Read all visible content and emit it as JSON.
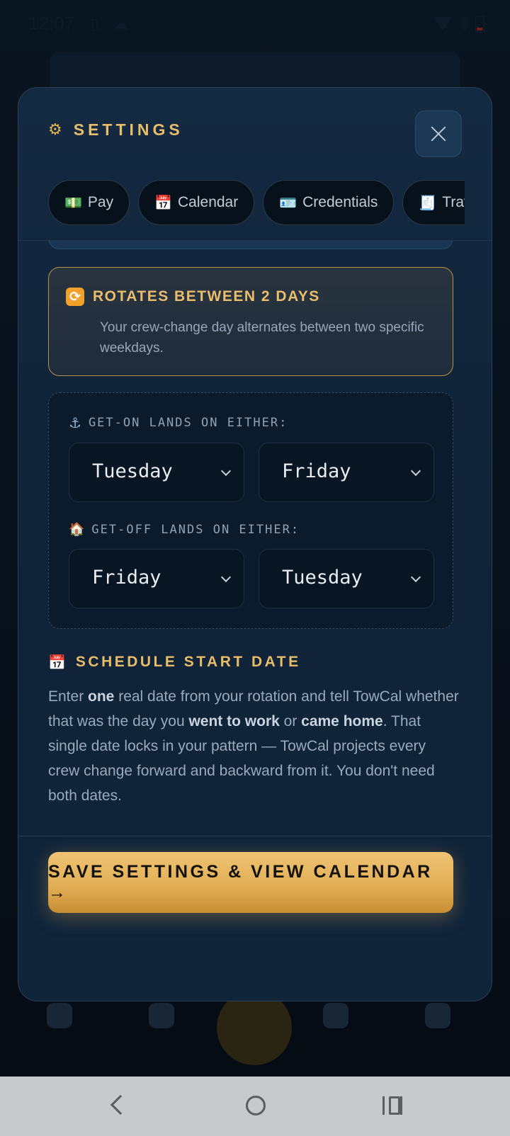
{
  "status_bar": {
    "time": "12:07",
    "left_icons": "▯ ☁"
  },
  "modal": {
    "title": "SETTINGS",
    "tabs": [
      {
        "icon": "💵",
        "label": "Pay"
      },
      {
        "icon": "📅",
        "label": "Calendar"
      },
      {
        "icon": "🪪",
        "label": "Credentials"
      },
      {
        "icon": "🧾",
        "label": "Travel"
      }
    ],
    "mode_card": {
      "title": "ROTATES BETWEEN 2 DAYS",
      "description": "Your crew-change day alternates between two specific weekdays."
    },
    "get_on": {
      "label": "GET-ON LANDS ON EITHER:",
      "day_1": "Tuesday",
      "day_2": "Friday"
    },
    "get_off": {
      "label": "GET-OFF LANDS ON EITHER:",
      "day_1": "Friday",
      "day_2": "Tuesday"
    },
    "schedule_start": {
      "heading": "SCHEDULE START DATE",
      "desc_1": "Enter ",
      "desc_b1": "one",
      "desc_2": " real date from your rotation and tell TowCal whether that was the day you ",
      "desc_b2": "went to work",
      "desc_3": " or ",
      "desc_b3": "came home",
      "desc_4": ". That single date locks in your pattern — TowCal projects every crew change forward and backward from it. You don't need both dates."
    },
    "save_label": "SAVE SETTINGS & VIEW CALENDAR →"
  },
  "colors": {
    "accent": "#e7bd6a",
    "modal_bg": "#10243a",
    "button_gold": "#e0ac53"
  }
}
